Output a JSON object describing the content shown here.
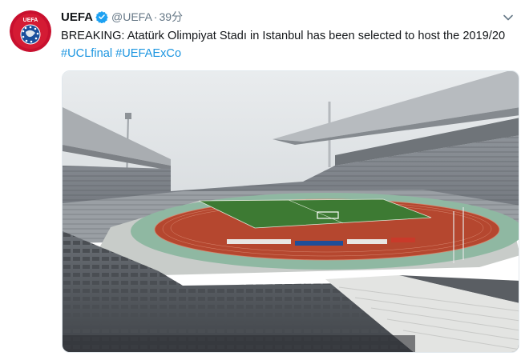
{
  "account": {
    "display_name": "UEFA",
    "handle": "@UEFA",
    "separator": "·",
    "timestamp": "39分",
    "verified": true,
    "avatar_text": "UEFA"
  },
  "tweet": {
    "text": "BREAKING: Atatürk Olimpiyat Stadı in Istanbul has been selected to host the 2019/20",
    "hashtags": [
      "#UCLfinal",
      "#UEFAExCo"
    ]
  },
  "colors": {
    "hashtag": "#1b95e0",
    "verified": "#1da1f2",
    "avatar_red": "#c8102e",
    "pitch": "#3d7a33",
    "track": "#b5472f"
  },
  "icons": {
    "verified": "verified-badge-icon",
    "menu": "chevron-down-icon"
  }
}
